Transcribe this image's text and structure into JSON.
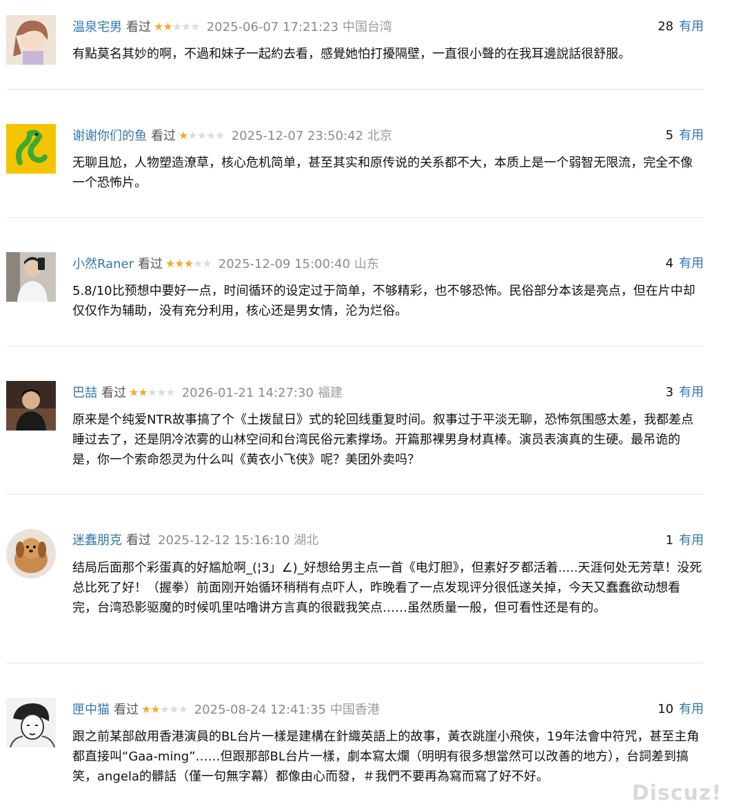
{
  "reviews": [
    {
      "user": "温泉宅男",
      "watched": "看过",
      "rating": 2,
      "time": "2025-06-07 17:21:23",
      "location": "中国台湾",
      "votes": "28",
      "useful_label": "有用",
      "avatar_icon": "anime-girl-avatar-icon",
      "text": "有點莫名其妙的啊，不過和妹子一起約去看，感覺她怕打擾隔壁，一直很小聲的在我耳邊說話很舒服。"
    },
    {
      "user": "谢谢你们的鱼",
      "watched": "看过",
      "rating": 1,
      "time": "2025-12-07 23:50:42",
      "location": "北京",
      "votes": "5",
      "useful_label": "有用",
      "avatar_icon": "green-lizard-avatar-icon",
      "text": "无聊且尬，人物塑造潦草，核心危机简单，甚至其实和原传说的关系都不大，本质上是一个弱智无限流，完全不像一个恐怖片。"
    },
    {
      "user": "小然Raner",
      "watched": "看过",
      "rating": 3,
      "time": "2025-12-09 15:00:40",
      "location": "山东",
      "votes": "4",
      "useful_label": "有用",
      "avatar_icon": "selfie-photo-avatar-icon",
      "text": "5.8/10比预想中要好一点，时间循环的设定过于简单，不够精彩，也不够恐怖。民俗部分本该是亮点，但在片中却仅仅作为辅助，没有充分利用，核心还是男女情，沦为烂俗。"
    },
    {
      "user": "巴喆",
      "watched": "看过",
      "rating": 2,
      "time": "2026-01-21 14:27:30",
      "location": "福建",
      "votes": "3",
      "useful_label": "有用",
      "avatar_icon": "man-portrait-avatar-icon",
      "text": "原来是个纯爱NTR故事搞了个《土拨鼠日》式的轮回线重复时间。叙事过于平淡无聊，恐怖氛围感太差，我都差点睡过去了，还是阴冷浓雾的山林空间和台湾民俗元素撑场。开篇那裸男身材真棒。演员表演真的生硬。最吊诡的是，你一个索命怨灵为什么叫《黄衣小飞侠》呢？美团外卖吗？"
    },
    {
      "user": "迷蠢朋克",
      "watched": "看过",
      "rating": 0,
      "time": "2025-12-12 15:16:10",
      "location": "湖北",
      "votes": "1",
      "useful_label": "有用",
      "avatar_icon": "plush-dog-avatar-icon",
      "text": "结局后面那个彩蛋真的好尴尬啊_(¦3」∠)_好想给男主点一首《电灯胆》，但素好歹都活着.....天涯何处无芳草！没死总比死了好！（握拳）前面刚开始循环稍稍有点吓人，昨晚看了一点发现评分很低遂关掉，今天又蠢蠢欲动想看完，台湾恐影驱魔的时候叽里咕噜讲方言真的很戳我笑点……虽然质量一般，但可看性还是有的。"
    },
    {
      "user": "匣中猫",
      "watched": "看过",
      "rating": 2,
      "time": "2025-08-24 12:41:35",
      "location": "中国香港",
      "votes": "10",
      "useful_label": "有用",
      "avatar_icon": "manga-sketch-avatar-icon",
      "text": "跟之前某部啟用香港演員的BL台片一樣是建構在針織英語上的故事，黃衣跳崖小飛俠，19年法會中符咒，甚至主角都直接叫“Gaa-ming”……但跟那部BL台片一樣，劇本寫太爛（明明有很多想當然可以改善的地方），台詞差到搞笑，angela的髒話（僅一句無字幕）都像由心而發，＃我們不要再為寫而寫了好不好。"
    }
  ],
  "watermark": "Discuz!",
  "colors": {
    "link": "#3377aa",
    "star_on": "#f7a92c",
    "star_off": "#dcdcdc"
  }
}
